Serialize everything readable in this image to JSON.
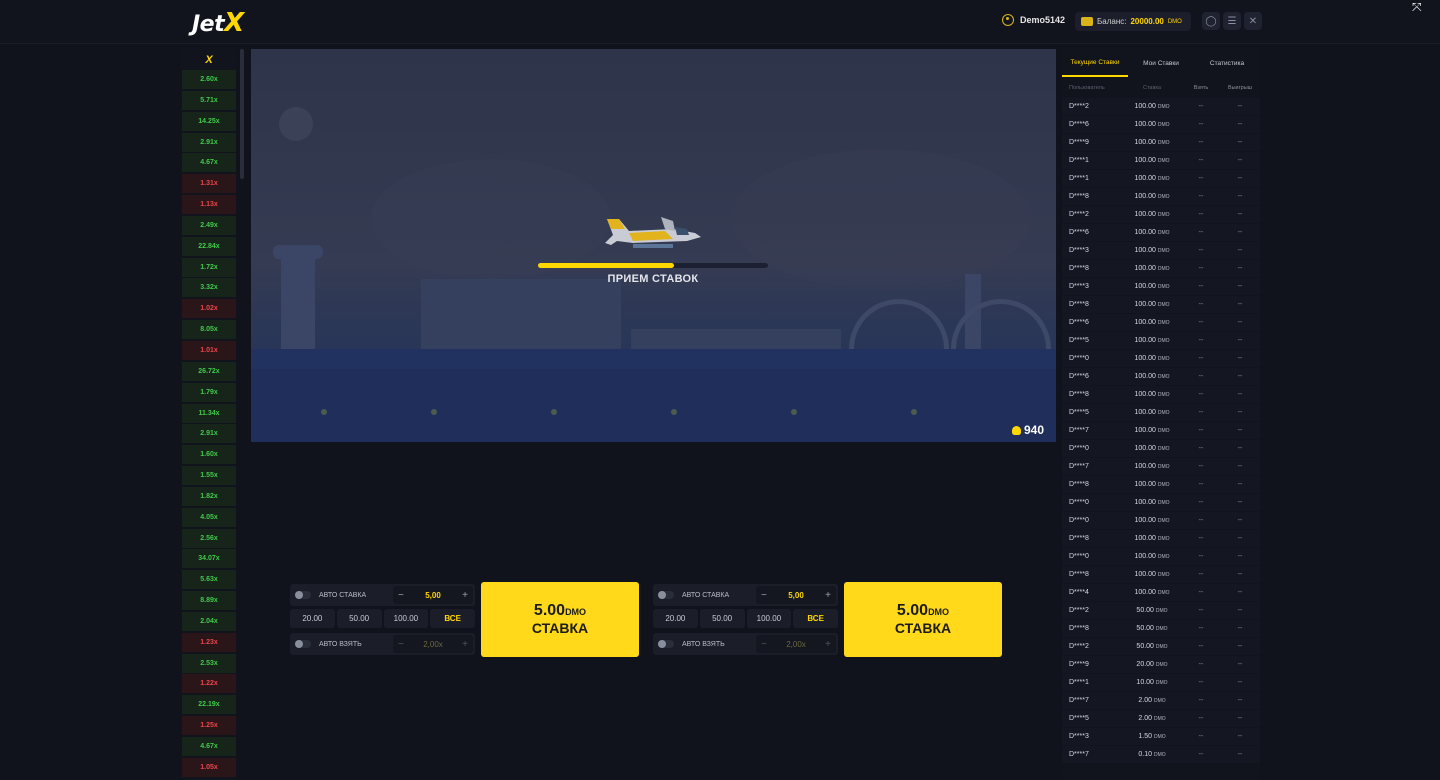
{
  "header": {
    "logo_main": "Jet",
    "logo_accent": "X",
    "username": "Demo5142",
    "balance_label": "Баланс:",
    "balance_value": "20000.00",
    "balance_currency": "DMO",
    "chat_icon": "chat-icon",
    "menu_icon": "menu-icon",
    "close_icon": "close-icon"
  },
  "history": {
    "header": "X",
    "items": [
      {
        "v": "2.60x",
        "c": "g"
      },
      {
        "v": "5.71x",
        "c": "g"
      },
      {
        "v": "14.25x",
        "c": "g"
      },
      {
        "v": "2.91x",
        "c": "g"
      },
      {
        "v": "4.67x",
        "c": "g"
      },
      {
        "v": "1.31x",
        "c": "r"
      },
      {
        "v": "1.13x",
        "c": "r"
      },
      {
        "v": "2.49x",
        "c": "g"
      },
      {
        "v": "22.84x",
        "c": "g"
      },
      {
        "v": "1.72x",
        "c": "g"
      },
      {
        "v": "3.32x",
        "c": "g"
      },
      {
        "v": "1.02x",
        "c": "r"
      },
      {
        "v": "8.05x",
        "c": "g"
      },
      {
        "v": "1.01x",
        "c": "r"
      },
      {
        "v": "26.72x",
        "c": "g"
      },
      {
        "v": "1.79x",
        "c": "g"
      },
      {
        "v": "11.34x",
        "c": "g"
      },
      {
        "v": "2.91x",
        "c": "g"
      },
      {
        "v": "1.60x",
        "c": "g"
      },
      {
        "v": "1.55x",
        "c": "g"
      },
      {
        "v": "1.82x",
        "c": "g"
      },
      {
        "v": "4.05x",
        "c": "g"
      },
      {
        "v": "2.56x",
        "c": "g"
      },
      {
        "v": "34.07x",
        "c": "g"
      },
      {
        "v": "5.63x",
        "c": "g"
      },
      {
        "v": "8.89x",
        "c": "g"
      },
      {
        "v": "2.04x",
        "c": "g"
      },
      {
        "v": "1.23x",
        "c": "r"
      },
      {
        "v": "2.53x",
        "c": "g"
      },
      {
        "v": "1.22x",
        "c": "r"
      },
      {
        "v": "22.19x",
        "c": "g"
      },
      {
        "v": "1.25x",
        "c": "r"
      },
      {
        "v": "4.67x",
        "c": "g"
      },
      {
        "v": "1.05x",
        "c": "r"
      }
    ]
  },
  "game": {
    "status": "ПРИЕМ СТАВОК",
    "progress": 0.59,
    "players": "940"
  },
  "panels": [
    {
      "auto_bet_label": "АВТО СТАВКА",
      "bet_value": "5,00",
      "quick": [
        "20.00",
        "50.00",
        "100.00",
        "ВСЕ"
      ],
      "auto_cash_label": "АВТО ВЗЯТЬ",
      "cash_value": "2,00x",
      "button_amount": "5.00",
      "button_currency": "DMO",
      "button_label": "СТАВКА"
    },
    {
      "auto_bet_label": "АВТО СТАВКА",
      "bet_value": "5,00",
      "quick": [
        "20.00",
        "50.00",
        "100.00",
        "ВСЕ"
      ],
      "auto_cash_label": "АВТО ВЗЯТЬ",
      "cash_value": "2,00x",
      "button_amount": "5.00",
      "button_currency": "DMO",
      "button_label": "СТАВКА"
    }
  ],
  "bets": {
    "tabs": [
      "Текущие Ставки",
      "Мои Ставки",
      "Статистика"
    ],
    "active_tab": 0,
    "columns": [
      "Пользователь",
      "Ставка",
      "Взять",
      "Выигрыш"
    ],
    "currency": "DMO",
    "rows": [
      {
        "u": "D****2",
        "b": "100.00",
        "x": "--",
        "w": "--"
      },
      {
        "u": "D****6",
        "b": "100.00",
        "x": "--",
        "w": "--"
      },
      {
        "u": "D****9",
        "b": "100.00",
        "x": "--",
        "w": "--"
      },
      {
        "u": "D****1",
        "b": "100.00",
        "x": "--",
        "w": "--"
      },
      {
        "u": "D****1",
        "b": "100.00",
        "x": "--",
        "w": "--"
      },
      {
        "u": "D****8",
        "b": "100.00",
        "x": "--",
        "w": "--"
      },
      {
        "u": "D****2",
        "b": "100.00",
        "x": "--",
        "w": "--"
      },
      {
        "u": "D****6",
        "b": "100.00",
        "x": "--",
        "w": "--"
      },
      {
        "u": "D****3",
        "b": "100.00",
        "x": "--",
        "w": "--"
      },
      {
        "u": "D****8",
        "b": "100.00",
        "x": "--",
        "w": "--"
      },
      {
        "u": "D****3",
        "b": "100.00",
        "x": "--",
        "w": "--"
      },
      {
        "u": "D****8",
        "b": "100.00",
        "x": "--",
        "w": "--"
      },
      {
        "u": "D****6",
        "b": "100.00",
        "x": "--",
        "w": "--"
      },
      {
        "u": "D****5",
        "b": "100.00",
        "x": "--",
        "w": "--"
      },
      {
        "u": "D****0",
        "b": "100.00",
        "x": "--",
        "w": "--"
      },
      {
        "u": "D****6",
        "b": "100.00",
        "x": "--",
        "w": "--"
      },
      {
        "u": "D****8",
        "b": "100.00",
        "x": "--",
        "w": "--"
      },
      {
        "u": "D****5",
        "b": "100.00",
        "x": "--",
        "w": "--"
      },
      {
        "u": "D****7",
        "b": "100.00",
        "x": "--",
        "w": "--"
      },
      {
        "u": "D****0",
        "b": "100.00",
        "x": "--",
        "w": "--"
      },
      {
        "u": "D****7",
        "b": "100.00",
        "x": "--",
        "w": "--"
      },
      {
        "u": "D****8",
        "b": "100.00",
        "x": "--",
        "w": "--"
      },
      {
        "u": "D****0",
        "b": "100.00",
        "x": "--",
        "w": "--"
      },
      {
        "u": "D****0",
        "b": "100.00",
        "x": "--",
        "w": "--"
      },
      {
        "u": "D****8",
        "b": "100.00",
        "x": "--",
        "w": "--"
      },
      {
        "u": "D****0",
        "b": "100.00",
        "x": "--",
        "w": "--"
      },
      {
        "u": "D****8",
        "b": "100.00",
        "x": "--",
        "w": "--"
      },
      {
        "u": "D****4",
        "b": "100.00",
        "x": "--",
        "w": "--"
      },
      {
        "u": "D****2",
        "b": "50.00",
        "x": "--",
        "w": "--"
      },
      {
        "u": "D****8",
        "b": "50.00",
        "x": "--",
        "w": "--"
      },
      {
        "u": "D****2",
        "b": "50.00",
        "x": "--",
        "w": "--"
      },
      {
        "u": "D****9",
        "b": "20.00",
        "x": "--",
        "w": "--"
      },
      {
        "u": "D****1",
        "b": "10.00",
        "x": "--",
        "w": "--"
      },
      {
        "u": "D****7",
        "b": "2.00",
        "x": "--",
        "w": "--"
      },
      {
        "u": "D****5",
        "b": "2.00",
        "x": "--",
        "w": "--"
      },
      {
        "u": "D****3",
        "b": "1.50",
        "x": "--",
        "w": "--"
      },
      {
        "u": "D****7",
        "b": "0.10",
        "x": "--",
        "w": "--"
      }
    ]
  },
  "colors": {
    "accent": "#ffd700",
    "win": "#41c94a",
    "loss": "#e8454a",
    "bg": "#11131c"
  }
}
